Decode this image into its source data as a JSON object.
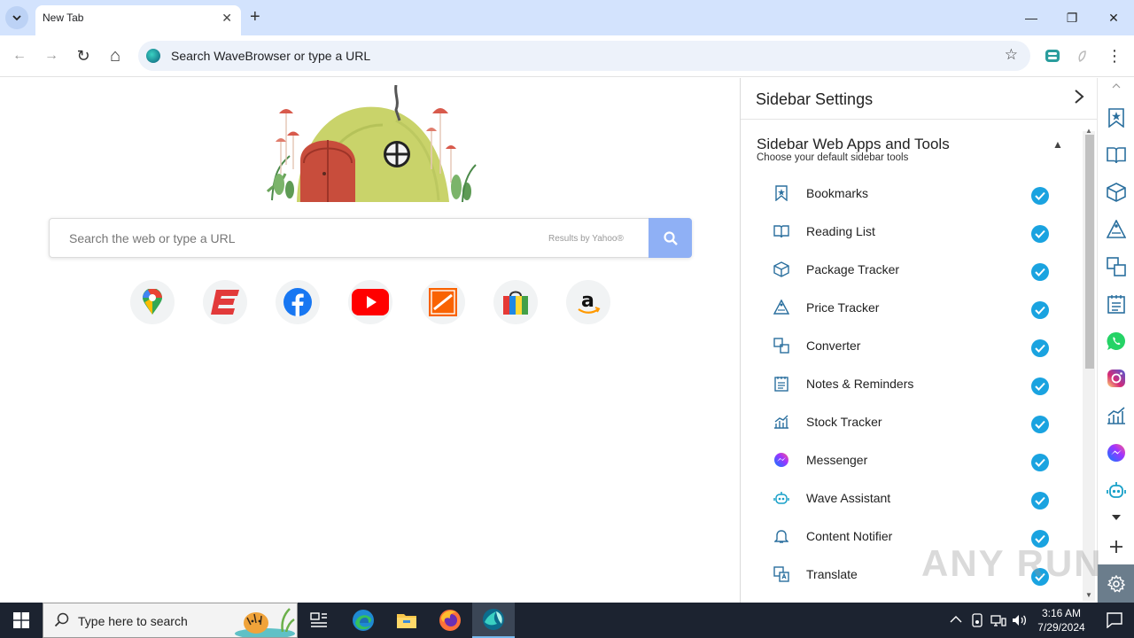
{
  "browser": {
    "tab_search_icon": "chevron-down-icon",
    "tab_title": "New Tab",
    "tab_close": "✕",
    "new_tab": "+",
    "window": {
      "minimize": "—",
      "maximize": "❐",
      "close": "✕"
    },
    "nav": {
      "back": "←",
      "forward": "→",
      "reload": "↻",
      "home": "⌂"
    },
    "omnibox_placeholder": "Search WaveBrowser or type a URL",
    "bookmark_star": "☆"
  },
  "ntp": {
    "search_placeholder": "Search the web or type a URL",
    "results_by": "Results by Yahoo®",
    "shortcuts": [
      "Google Maps",
      "ESPN",
      "Facebook",
      "YouTube",
      "The Home Depot",
      "Shopping",
      "Amazon"
    ]
  },
  "sidebar_settings": {
    "title": "Sidebar Settings",
    "section_title": "Sidebar Web Apps and Tools",
    "section_subtitle": "Choose your default sidebar tools",
    "tools": [
      {
        "label": "Bookmarks",
        "icon": "bookmark-icon",
        "enabled": true
      },
      {
        "label": "Reading List",
        "icon": "book-icon",
        "enabled": true
      },
      {
        "label": "Package Tracker",
        "icon": "package-icon",
        "enabled": true
      },
      {
        "label": "Price Tracker",
        "icon": "price-tag-icon",
        "enabled": true
      },
      {
        "label": "Converter",
        "icon": "converter-icon",
        "enabled": true
      },
      {
        "label": "Notes & Reminders",
        "icon": "notes-icon",
        "enabled": true
      },
      {
        "label": "Stock Tracker",
        "icon": "stock-chart-icon",
        "enabled": true
      },
      {
        "label": "Messenger",
        "icon": "messenger-icon",
        "enabled": true
      },
      {
        "label": "Wave Assistant",
        "icon": "robot-icon",
        "enabled": true
      },
      {
        "label": "Content Notifier",
        "icon": "bell-icon",
        "enabled": true
      },
      {
        "label": "Translate",
        "icon": "translate-icon",
        "enabled": true
      }
    ]
  },
  "rail": [
    "bookmark-icon",
    "book-icon",
    "package-icon",
    "price-tag-icon",
    "converter-icon",
    "notes-icon",
    "whatsapp-icon",
    "instagram-icon",
    "stock-chart-icon",
    "messenger-icon",
    "robot-icon",
    "chevron-down-icon",
    "plus-icon",
    "gear-icon"
  ],
  "watermark": "ANY RUN",
  "taskbar": {
    "search_placeholder": "Type here to search",
    "time": "3:16 AM",
    "date": "7/29/2024"
  },
  "colors": {
    "titlebar": "#d3e3fd",
    "check": "#1aa3e0",
    "search_button": "#8fb0f5",
    "taskbar": "#1c2330"
  }
}
